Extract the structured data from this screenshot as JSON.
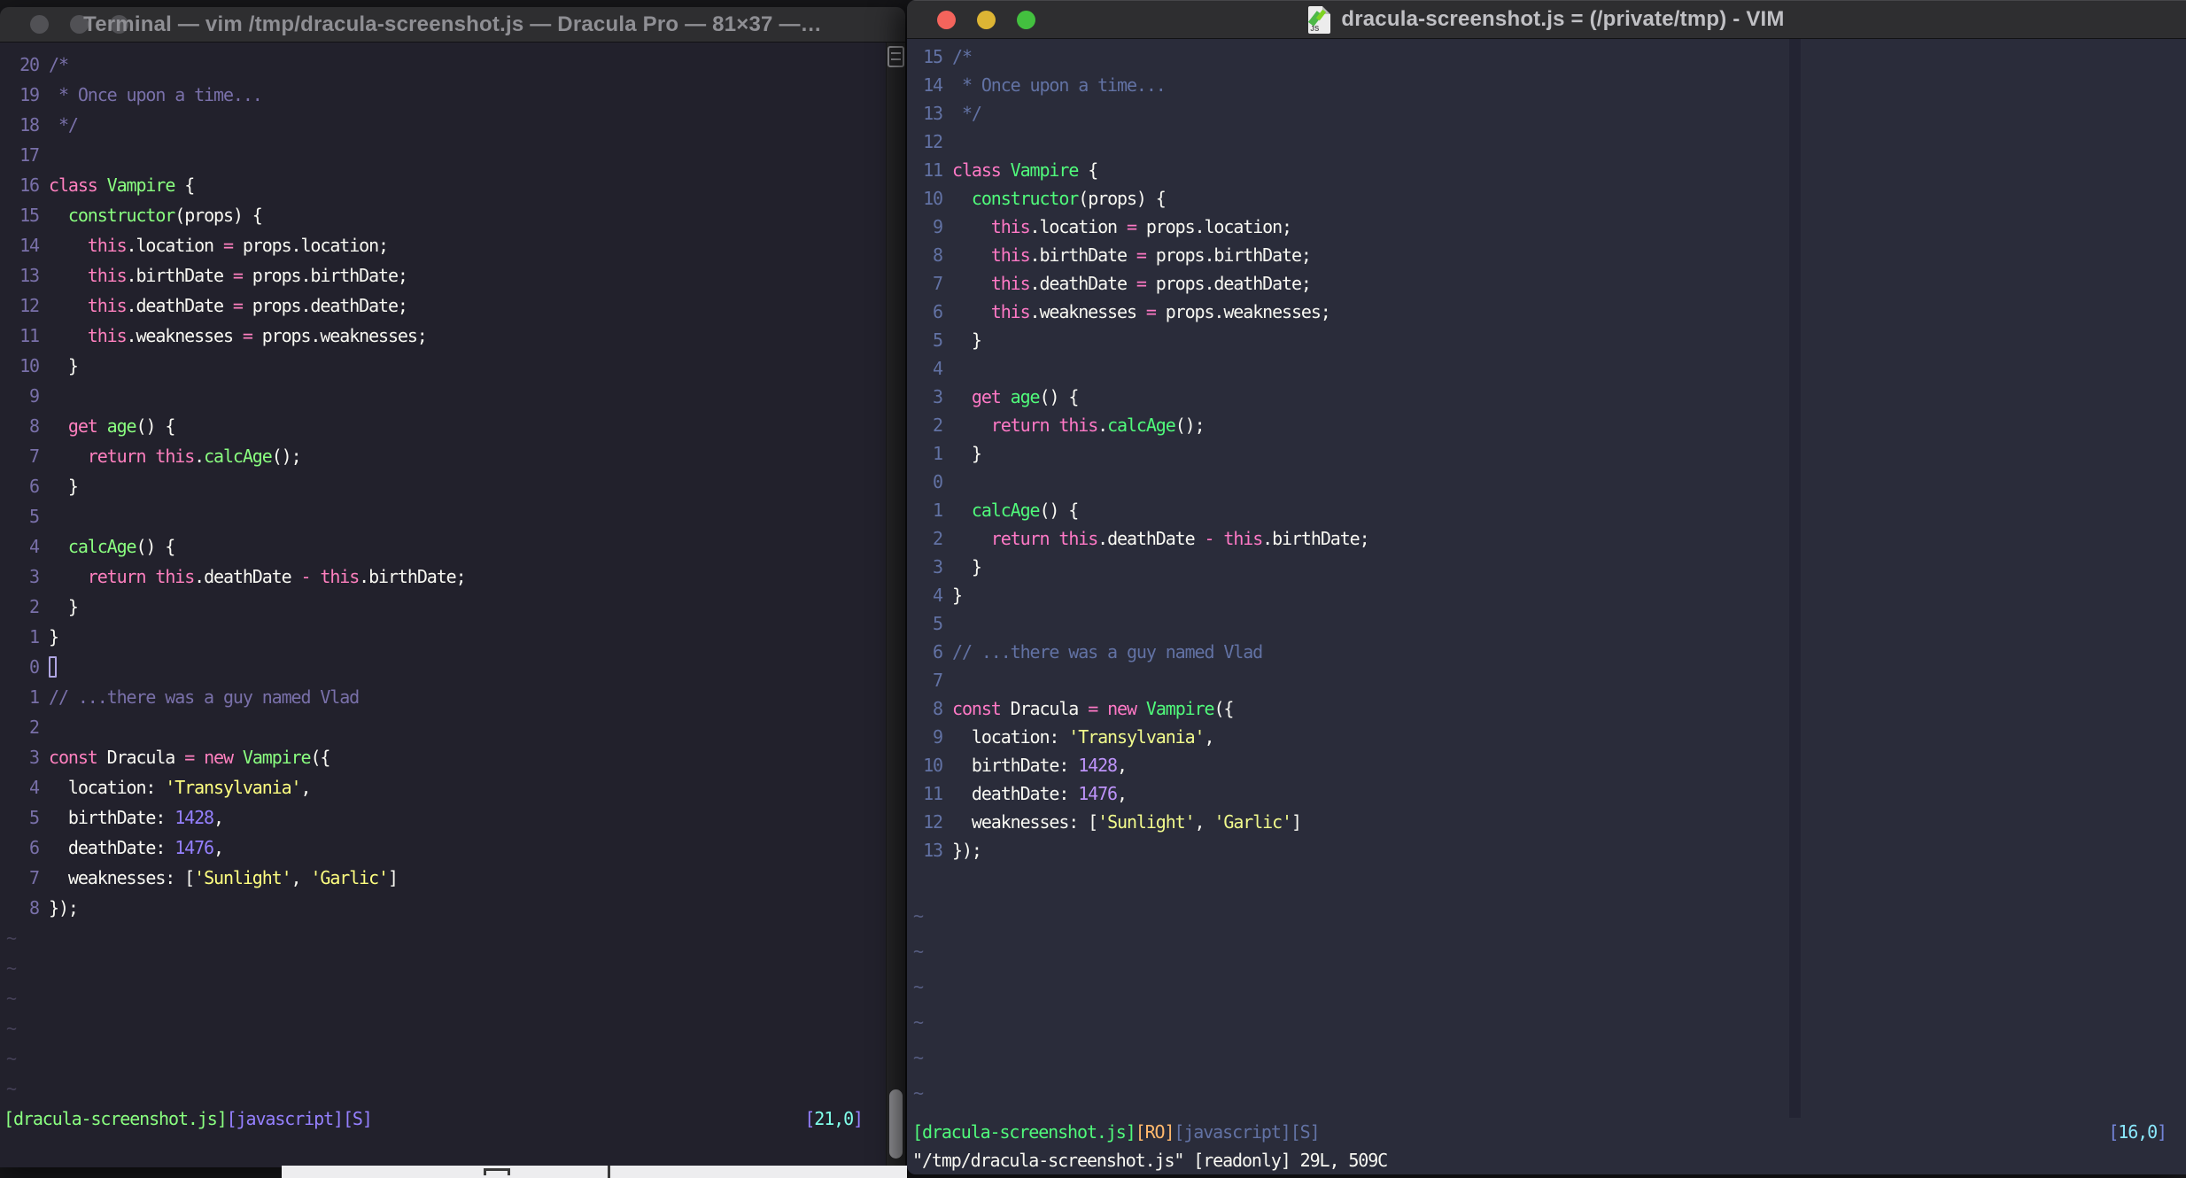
{
  "left_window": {
    "title": "Terminal — vim /tmp/dracula-screenshot.js — Dracula Pro — 81×37 —…",
    "theme_name": "Dracula Pro",
    "window_buttons": [
      "close",
      "minimize",
      "zoom"
    ],
    "line_numbers": [
      "20",
      "19",
      "18",
      "17",
      "16",
      "15",
      "14",
      "13",
      "12",
      "11",
      "10",
      "9",
      "8",
      "7",
      "6",
      "5",
      "4",
      "3",
      "2",
      "1",
      "0",
      "1",
      "2",
      "3",
      "4",
      "5",
      "6",
      "7",
      "8"
    ],
    "cursor_line_index": 20,
    "cursor_visible": true,
    "tilde_rows": 6,
    "statusline": {
      "segments": [
        [
          "[dracula-screenshot.js]",
          "seg-green-l"
        ],
        [
          "[javascript]",
          "seg-purple"
        ],
        [
          "[S]",
          "seg-purple"
        ]
      ],
      "position": [
        [
          "[",
          "seg-purple"
        ],
        [
          "21,0",
          "seg-cyan-l"
        ],
        [
          "]",
          "seg-purple"
        ]
      ]
    },
    "colors": {
      "bg": "#22212c",
      "fg": "#f8f8f2",
      "comment": "#7970a9",
      "line_number": "#7970a9",
      "pink": "#ff80bf",
      "green": "#8aff80",
      "yellow": "#ffff80",
      "purple": "#9580ff",
      "cyan": "#80ffea",
      "tilde": "#454158",
      "titlebar": "#2e2e30",
      "title_text": "#8f8f94",
      "traffic_inactive": "#515155"
    }
  },
  "right_window": {
    "title": "dracula-screenshot.js = (/private/tmp) - VIM",
    "app_name": "VIM",
    "window_buttons": [
      "close",
      "minimize",
      "zoom"
    ],
    "line_numbers": [
      "15",
      "14",
      "13",
      "12",
      "11",
      "10",
      "9",
      "8",
      "7",
      "6",
      "5",
      "4",
      "3",
      "2",
      "1",
      "0",
      "1",
      "2",
      "3",
      "4",
      "5",
      "6",
      "7",
      "8",
      "9",
      "10",
      "11",
      "12",
      "13"
    ],
    "cursor_line_index": 15,
    "cursor_visible": false,
    "tilde_rows": 6,
    "statusline": {
      "segments": [
        [
          "[dracula-screenshot.js]",
          "seg-green-r"
        ],
        [
          "[RO]",
          "seg-orange"
        ],
        [
          "[javascript]",
          "seg-slate"
        ],
        [
          "[S]",
          "seg-slate"
        ]
      ],
      "position": [
        [
          "[",
          "seg-indigo"
        ],
        [
          "16,0",
          "seg-cyan-r"
        ],
        [
          "]",
          "seg-indigo"
        ]
      ]
    },
    "command_line": "\"/tmp/dracula-screenshot.js\" [readonly] 29L, 509C",
    "colors": {
      "bg": "#2a2c3a",
      "fg": "#f8f8f2",
      "comment": "#6272a4",
      "line_number": "#6272a4",
      "pink": "#ff79c6",
      "green": "#50fa7b",
      "yellow": "#f1fa8c",
      "purple": "#bd93f9",
      "cyan": "#8be9fd",
      "orange": "#ffb86c",
      "tilde": "#565d81",
      "colorcolumn": "#232433",
      "titlebar": "#2e2e30",
      "title_text": "#c0c0c4",
      "traffic_red": "#f4645c",
      "traffic_yellow": "#ddb534",
      "traffic_green": "#43c03f"
    }
  },
  "code_lines": [
    [
      [
        "/*",
        "c"
      ]
    ],
    [
      [
        " * Once upon a time...",
        "c"
      ]
    ],
    [
      [
        " */",
        "c"
      ]
    ],
    [],
    [
      [
        "class",
        "p"
      ],
      [
        " ",
        "f"
      ],
      [
        "Vampire",
        "g"
      ],
      [
        " {",
        "f"
      ]
    ],
    [
      [
        "  ",
        "f"
      ],
      [
        "constructor",
        "g"
      ],
      [
        "(props) {",
        "f"
      ]
    ],
    [
      [
        "    ",
        "f"
      ],
      [
        "this",
        "p"
      ],
      [
        ".location ",
        "f"
      ],
      [
        "=",
        "p"
      ],
      [
        " props.location;",
        "f"
      ]
    ],
    [
      [
        "    ",
        "f"
      ],
      [
        "this",
        "p"
      ],
      [
        ".birthDate ",
        "f"
      ],
      [
        "=",
        "p"
      ],
      [
        " props.birthDate;",
        "f"
      ]
    ],
    [
      [
        "    ",
        "f"
      ],
      [
        "this",
        "p"
      ],
      [
        ".deathDate ",
        "f"
      ],
      [
        "=",
        "p"
      ],
      [
        " props.deathDate;",
        "f"
      ]
    ],
    [
      [
        "    ",
        "f"
      ],
      [
        "this",
        "p"
      ],
      [
        ".weaknesses ",
        "f"
      ],
      [
        "=",
        "p"
      ],
      [
        " props.weaknesses;",
        "f"
      ]
    ],
    [
      [
        "  }",
        "f"
      ]
    ],
    [],
    [
      [
        "  ",
        "f"
      ],
      [
        "get",
        "p"
      ],
      [
        " ",
        "f"
      ],
      [
        "age",
        "g"
      ],
      [
        "() {",
        "f"
      ]
    ],
    [
      [
        "    ",
        "f"
      ],
      [
        "return",
        "p"
      ],
      [
        " ",
        "f"
      ],
      [
        "this",
        "p"
      ],
      [
        ".",
        "f"
      ],
      [
        "calcAge",
        "g"
      ],
      [
        "();",
        "f"
      ]
    ],
    [
      [
        "  }",
        "f"
      ]
    ],
    [],
    [
      [
        "  ",
        "f"
      ],
      [
        "calcAge",
        "g"
      ],
      [
        "() {",
        "f"
      ]
    ],
    [
      [
        "    ",
        "f"
      ],
      [
        "return",
        "p"
      ],
      [
        " ",
        "f"
      ],
      [
        "this",
        "p"
      ],
      [
        ".deathDate ",
        "f"
      ],
      [
        "-",
        "p"
      ],
      [
        " ",
        "f"
      ],
      [
        "this",
        "p"
      ],
      [
        ".birthDate;",
        "f"
      ]
    ],
    [
      [
        "  }",
        "f"
      ]
    ],
    [
      [
        "}",
        "f"
      ]
    ],
    [],
    [
      [
        "// ...there was a guy named Vlad",
        "c"
      ]
    ],
    [],
    [
      [
        "const",
        "p"
      ],
      [
        " Dracula ",
        "f"
      ],
      [
        "=",
        "p"
      ],
      [
        " ",
        "f"
      ],
      [
        "new",
        "p"
      ],
      [
        " ",
        "f"
      ],
      [
        "Vampire",
        "g"
      ],
      [
        "({",
        "f"
      ]
    ],
    [
      [
        "  location: ",
        "f"
      ],
      [
        "'Transylvania'",
        "y"
      ],
      [
        ",",
        "f"
      ]
    ],
    [
      [
        "  birthDate: ",
        "f"
      ],
      [
        "1428",
        "u"
      ],
      [
        ",",
        "f"
      ]
    ],
    [
      [
        "  deathDate: ",
        "f"
      ],
      [
        "1476",
        "u"
      ],
      [
        ",",
        "f"
      ]
    ],
    [
      [
        "  weaknesses: [",
        "f"
      ],
      [
        "'Sunlight'",
        "y"
      ],
      [
        ", ",
        "f"
      ],
      [
        "'Garlic'",
        "y"
      ],
      [
        "]",
        "f"
      ]
    ],
    [
      [
        "});",
        "f"
      ]
    ]
  ]
}
